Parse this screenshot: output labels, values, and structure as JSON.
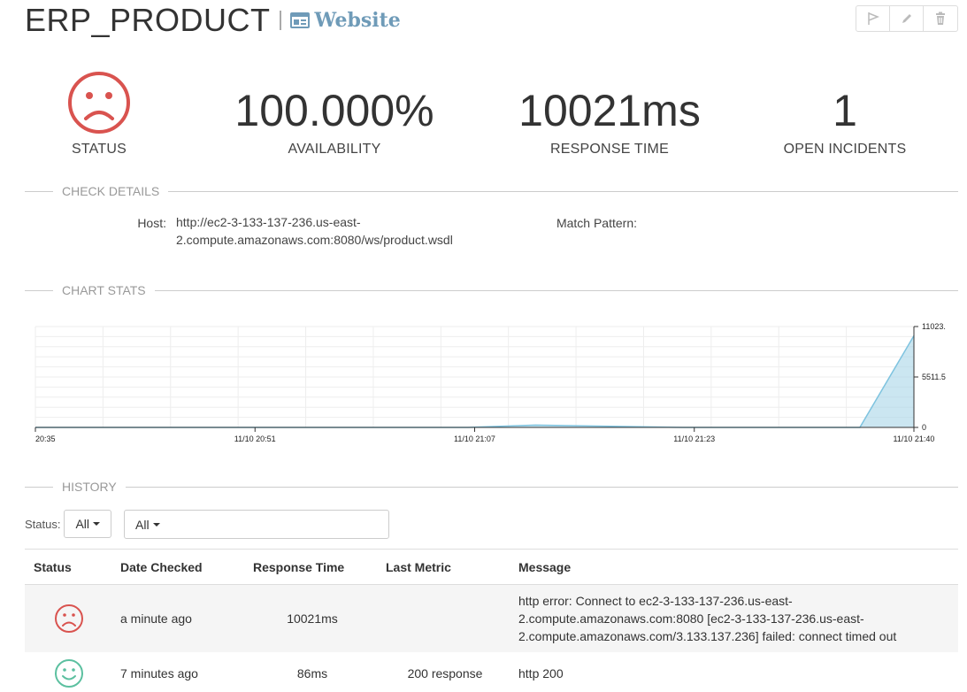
{
  "header": {
    "title": "ERP_PRODUCT",
    "type_label": "Website",
    "type_icon": "browser-window-icon",
    "actions": [
      {
        "name": "flag-button",
        "icon": "flag-icon"
      },
      {
        "name": "edit-button",
        "icon": "pencil-icon"
      },
      {
        "name": "delete-button",
        "icon": "trash-icon"
      }
    ]
  },
  "stats": {
    "status_label": "STATUS",
    "status_icon": "sad-face-icon",
    "availability_value": "100.000%",
    "availability_label": "AVAILABILITY",
    "response_value": "10021ms",
    "response_label": "RESPONSE TIME",
    "incidents_value": "1",
    "incidents_label": "OPEN INCIDENTS"
  },
  "check_details": {
    "section_title": "CHECK DETAILS",
    "host_label": "Host:",
    "host_line1": "http://ec2-3-133-137-236.us-east-",
    "host_line2": "2.compute.amazonaws.com:8080/ws/product.wsdl",
    "match_label": "Match Pattern:",
    "match_value": ""
  },
  "chart_section": {
    "section_title": "CHART STATS"
  },
  "chart_data": {
    "type": "area",
    "x_tick_labels": [
      "20:35",
      "11/10 20:51",
      "11/10 21:07",
      "11/10 21:23",
      "11/10 21:40"
    ],
    "y_tick_labels": [
      "11023.",
      "5511.5",
      "0"
    ],
    "ylim": [
      0,
      11023
    ],
    "x": [
      "20:35",
      "20:51",
      "21:07",
      "21:12",
      "21:23",
      "21:36",
      "21:40"
    ],
    "values": [
      0,
      0,
      0,
      250,
      0,
      0,
      10021
    ],
    "grid": true,
    "color": "#a9d6e8",
    "line_color": "#7ec3df"
  },
  "history": {
    "section_title": "HISTORY",
    "status_filter_label": "Status:",
    "status_filter_value": "All",
    "type_filter_value": "All",
    "columns": [
      "Status",
      "Date Checked",
      "Response Time",
      "Last Metric",
      "Message"
    ],
    "rows": [
      {
        "status_icon": "sad-face-icon",
        "date": "a minute ago",
        "response": "10021ms",
        "metric": "",
        "message_line1": "http error: Connect to ec2-3-133-137-236.us-east-",
        "message_line2": "2.compute.amazonaws.com:8080 [ec2-3-133-137-236.us-east-",
        "message_line3": "2.compute.amazonaws.com/3.133.137.236] failed: connect timed out"
      },
      {
        "status_icon": "happy-face-icon",
        "date": "7 minutes ago",
        "response": "86ms",
        "metric": "200 response",
        "message_line1": "http 200"
      }
    ]
  },
  "colors": {
    "error": "#d9534f",
    "ok": "#5cb85c",
    "link": "#6f9bb8"
  }
}
